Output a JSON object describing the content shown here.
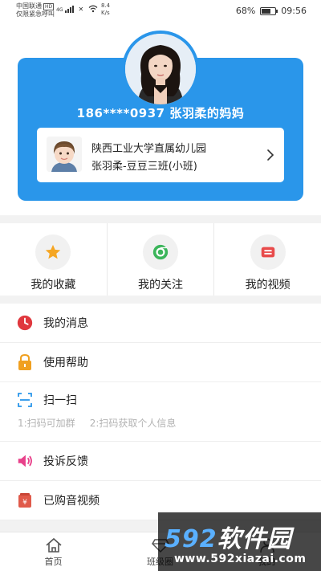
{
  "status_bar": {
    "carrier_line1": "中国联通",
    "hd_badge": "HD",
    "carrier_line2": "仅限紧急呼叫",
    "net_label": "4G",
    "speed_value": "8.4",
    "speed_unit": "K/s",
    "battery_text": "68%",
    "battery_level": 0.68,
    "time": "09:56"
  },
  "profile": {
    "parent_display": "186****0937 张羽柔的妈妈",
    "school": "陕西工业大学直属幼儿园",
    "class_info": "张羽柔-豆豆三班(小班)"
  },
  "quick_actions": [
    {
      "label": "我的收藏",
      "icon": "star-icon",
      "color": "#f5a623"
    },
    {
      "label": "我的关注",
      "icon": "chrome-icon",
      "color": "#3bb55a"
    },
    {
      "label": "我的视频",
      "icon": "video-ticket-icon",
      "color": "#e84b4b"
    }
  ],
  "menu": {
    "messages": "我的消息",
    "help": "使用帮助",
    "scan": "扫一扫",
    "scan_hint1": "1:扫码可加群",
    "scan_hint2": "2:扫码获取个人信息",
    "feedback": "投诉反馈",
    "purchased": "已购音视频"
  },
  "bottom_nav": {
    "home": "首页",
    "class_circle": "班级圈",
    "mine": "我的"
  },
  "watermark": {
    "logo_num": "592",
    "logo_text": "软件园",
    "url": "www.592xiazai.com"
  },
  "colors": {
    "primary": "#2a96ea",
    "clock_red": "#e0383e",
    "lock_orange": "#f0a020",
    "scan_blue": "#2a96ea",
    "speaker_pink": "#e8418a",
    "purchase_red": "#e05a4a"
  }
}
